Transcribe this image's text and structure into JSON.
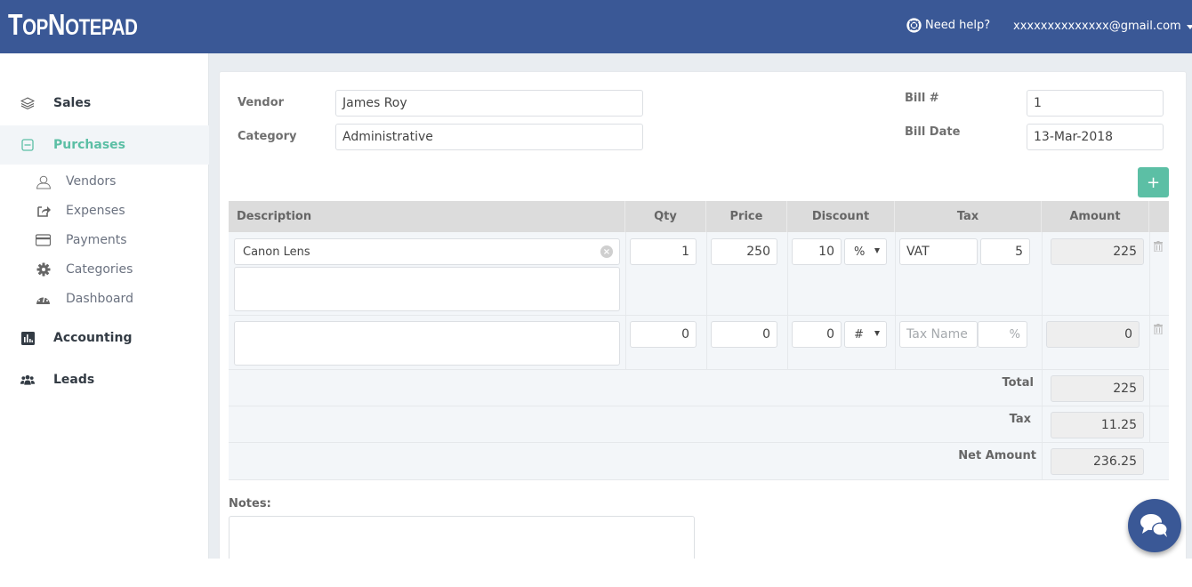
{
  "header": {
    "logo": {
      "t1": "T",
      "t2": "OP",
      "t3": "N",
      "t4": "OTEPAD"
    },
    "help_label": "Need help?",
    "account_email": "xxxxxxxxxxxxxx@gmail.com"
  },
  "sidebar": {
    "sales": "Sales",
    "purchases": "Purchases",
    "sub": {
      "vendors": "Vendors",
      "expenses": "Expenses",
      "payments": "Payments",
      "categories": "Categories",
      "dashboard": "Dashboard"
    },
    "accounting": "Accounting",
    "leads": "Leads"
  },
  "form": {
    "vendor_label": "Vendor",
    "vendor_value": "James Roy",
    "category_label": "Category",
    "category_value": "Administrative",
    "bill_no_label": "Bill #",
    "bill_no_value": "1",
    "bill_date_label": "Bill Date",
    "bill_date_value": "13-Mar-2018",
    "add_label": "+"
  },
  "table": {
    "headers": {
      "description": "Description",
      "qty": "Qty",
      "price": "Price",
      "discount": "Discount",
      "tax": "Tax",
      "amount": "Amount"
    },
    "rows": [
      {
        "description": "Canon Lens",
        "qty": "1",
        "price": "250",
        "discount": "10",
        "discount_type": "%",
        "tax_name": "VAT",
        "tax_rate": "5",
        "amount": "225"
      },
      {
        "description": "",
        "qty": "0",
        "price": "0",
        "discount": "0",
        "discount_type": "#",
        "tax_name": "",
        "tax_name_placeholder": "Tax Name",
        "tax_rate": "",
        "tax_rate_placeholder": "%",
        "amount": "0"
      }
    ],
    "summary": {
      "total_label": "Total",
      "total_value": "225",
      "tax_label": "Tax",
      "tax_value": "11.25",
      "net_label": "Net Amount",
      "net_value": "236.25"
    }
  },
  "notes": {
    "label": "Notes:",
    "value": ""
  },
  "colors": {
    "brand": "#3a5896",
    "accent": "#5cbfa5"
  }
}
